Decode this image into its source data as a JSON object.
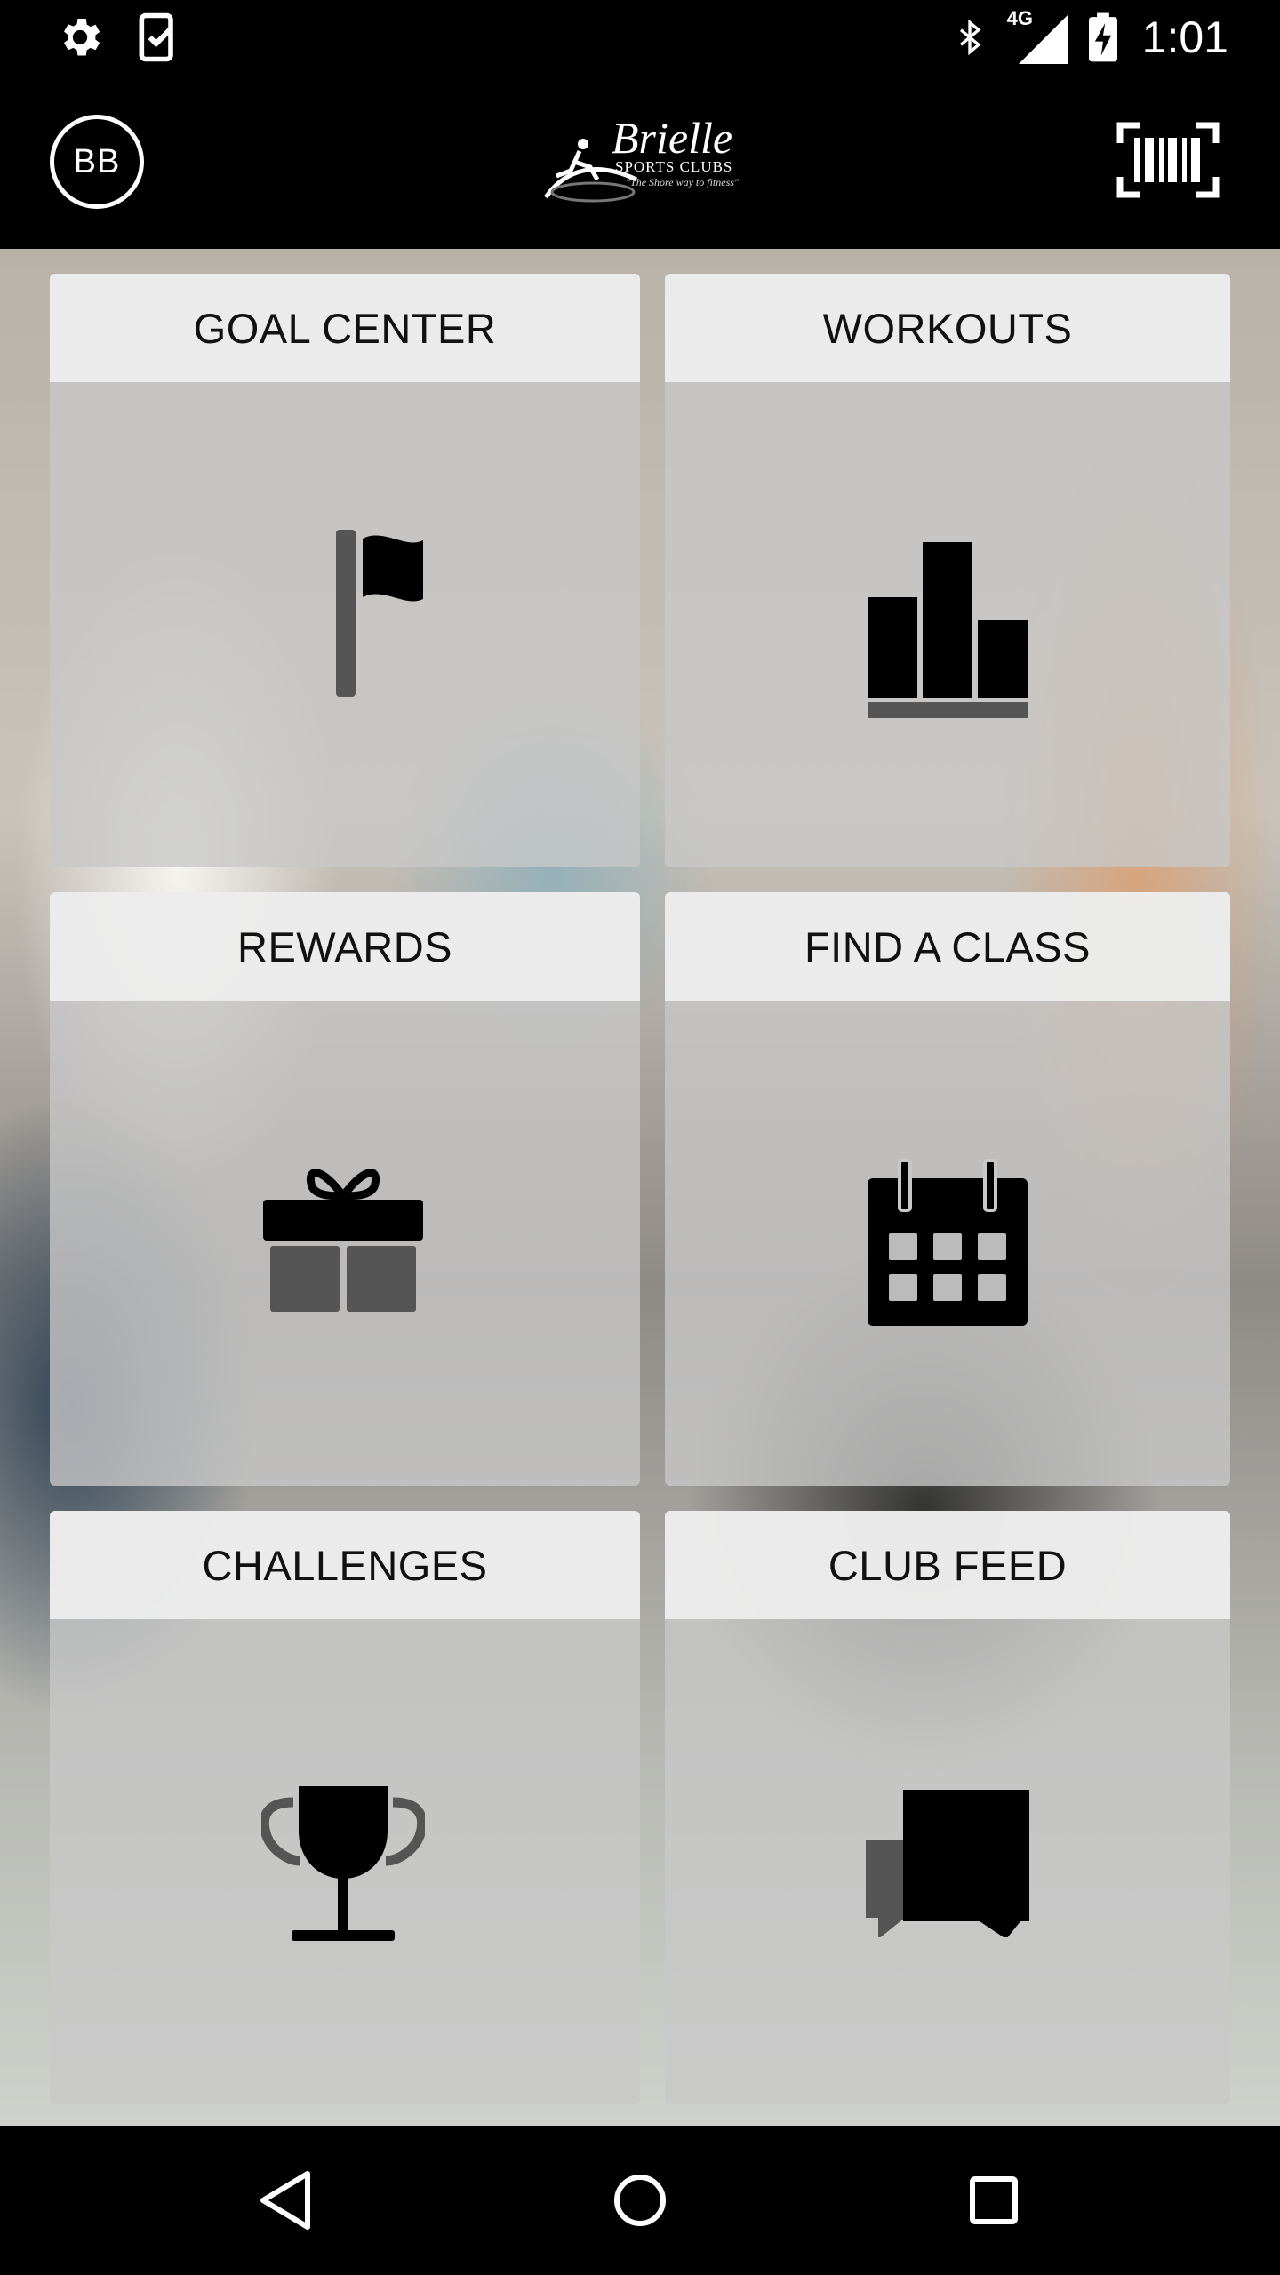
{
  "status_bar": {
    "time": "1:01",
    "network": "4G",
    "icons": [
      "settings-icon",
      "task-check-icon",
      "bluetooth-icon",
      "cell-signal-icon",
      "battery-charging-icon"
    ]
  },
  "app_bar": {
    "avatar_initials": "BB",
    "logo": {
      "title": "Brielle",
      "subtitle": "SPORTS CLUBS",
      "tagline": "\"The Shore way to fitness\""
    },
    "barcode_icon": "barcode-scanner-icon"
  },
  "tiles": [
    {
      "label": "GOAL CENTER",
      "icon": "flag-icon"
    },
    {
      "label": "WORKOUTS",
      "icon": "bar-chart-icon"
    },
    {
      "label": "REWARDS",
      "icon": "gift-icon"
    },
    {
      "label": "FIND A CLASS",
      "icon": "calendar-icon"
    },
    {
      "label": "CHALLENGES",
      "icon": "trophy-icon"
    },
    {
      "label": "CLUB FEED",
      "icon": "chat-icon"
    }
  ],
  "nav_bar": {
    "icons": [
      "back-icon",
      "home-icon",
      "recents-icon"
    ]
  },
  "colors": {
    "background": "#000000",
    "tile_header": "#eeeeee",
    "icon": "#000000",
    "icon_secondary": "#555555"
  }
}
